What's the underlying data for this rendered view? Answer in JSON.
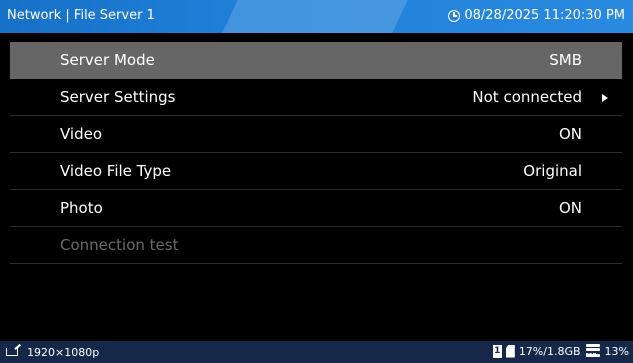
{
  "header": {
    "title": "Network | File Server 1",
    "datetime": "08/28/2025 11:20:30 PM"
  },
  "menu": {
    "items": [
      {
        "label": "Server Mode",
        "value": "SMB",
        "selected": true
      },
      {
        "label": "Server Settings",
        "value": "Not connected",
        "has_submenu": true
      },
      {
        "label": "Video",
        "value": "ON"
      },
      {
        "label": "Video File Type",
        "value": "Original"
      },
      {
        "label": "Photo",
        "value": "ON"
      },
      {
        "label": "Connection test",
        "value": "",
        "disabled": true
      }
    ]
  },
  "footer": {
    "resolution": "1920×1080p",
    "slot_number": "1",
    "card_usage": "17%/1.8GB",
    "drive_label": "SSD",
    "drive_usage": "13%"
  },
  "colors": {
    "header_bg": "#1f7fd8",
    "selected_row_bg": "#666666",
    "footer_bg": "#16284a",
    "disabled_text": "#6a6a6a"
  }
}
